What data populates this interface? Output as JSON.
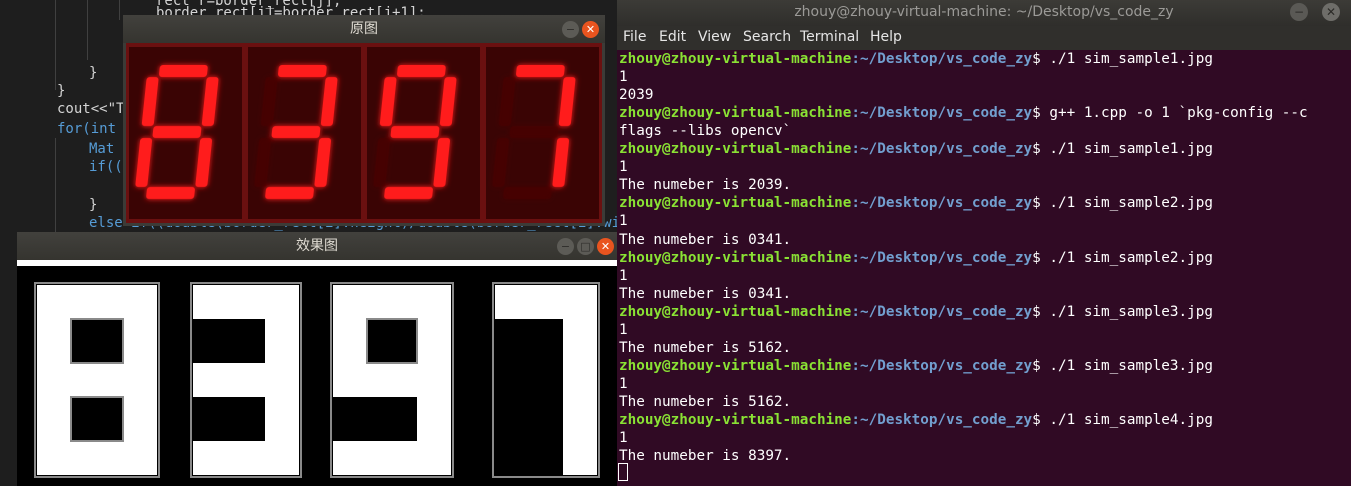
{
  "editor": {
    "lines": [
      "rect r=border_rect[j];",
      "border_rect[j]=border_rect[j+1];",
      "}",
      "}",
      "cout<<\"T",
      "for(int",
      "Mat",
      "if((",
      "}",
      "else if((double(border_rect[i].height)/double(border_rect[i].wi"
    ]
  },
  "terminal": {
    "title": "zhouy@zhouy-virtual-machine: ~/Desktop/vs_code_zy",
    "window_buttons": {
      "minimize": "−",
      "close": "✕"
    },
    "menu": [
      "File",
      "Edit",
      "View",
      "Search",
      "Terminal",
      "Help"
    ],
    "prompt_user": "zhouy@zhouy-virtual-machine",
    "prompt_path": ":~/Desktop/vs_code_zy",
    "prompt_symbol": "$",
    "lines": [
      {
        "type": "cmd",
        "text": " ./1 sim_sample1.jpg"
      },
      {
        "type": "out",
        "text": "1"
      },
      {
        "type": "out",
        "text": "2039"
      },
      {
        "type": "cmd",
        "text": " g++ 1.cpp -o 1 `pkg-config --c"
      },
      {
        "type": "out",
        "text": "flags --libs opencv`"
      },
      {
        "type": "cmd",
        "text": " ./1 sim_sample1.jpg"
      },
      {
        "type": "out",
        "text": "1"
      },
      {
        "type": "out",
        "text": "The numeber is 2039."
      },
      {
        "type": "cmd",
        "text": " ./1 sim_sample2.jpg"
      },
      {
        "type": "out",
        "text": "1"
      },
      {
        "type": "out",
        "text": "The numeber is 0341."
      },
      {
        "type": "cmd",
        "text": " ./1 sim_sample2.jpg"
      },
      {
        "type": "out",
        "text": "1"
      },
      {
        "type": "out",
        "text": "The numeber is 0341."
      },
      {
        "type": "cmd",
        "text": " ./1 sim_sample3.jpg"
      },
      {
        "type": "out",
        "text": "1"
      },
      {
        "type": "out",
        "text": "The numeber is 5162."
      },
      {
        "type": "cmd",
        "text": " ./1 sim_sample3.jpg"
      },
      {
        "type": "out",
        "text": "1"
      },
      {
        "type": "out",
        "text": "The numeber is 5162."
      },
      {
        "type": "cmd",
        "text": " ./1 sim_sample4.jpg"
      },
      {
        "type": "out",
        "text": "1"
      },
      {
        "type": "out",
        "text": "The numeber is 8397."
      }
    ]
  },
  "original_window": {
    "title": "原图",
    "digits": [
      "8",
      "3",
      "9",
      "7"
    ],
    "digit_color": "#ff1a1a",
    "close_glyph": "✕",
    "minimize_glyph": "−"
  },
  "result_window": {
    "title": "效果图",
    "digits": [
      "8",
      "3",
      "9",
      "7"
    ],
    "minimize_glyph": "−",
    "maximize_glyph": "□",
    "close_glyph": "✕"
  }
}
